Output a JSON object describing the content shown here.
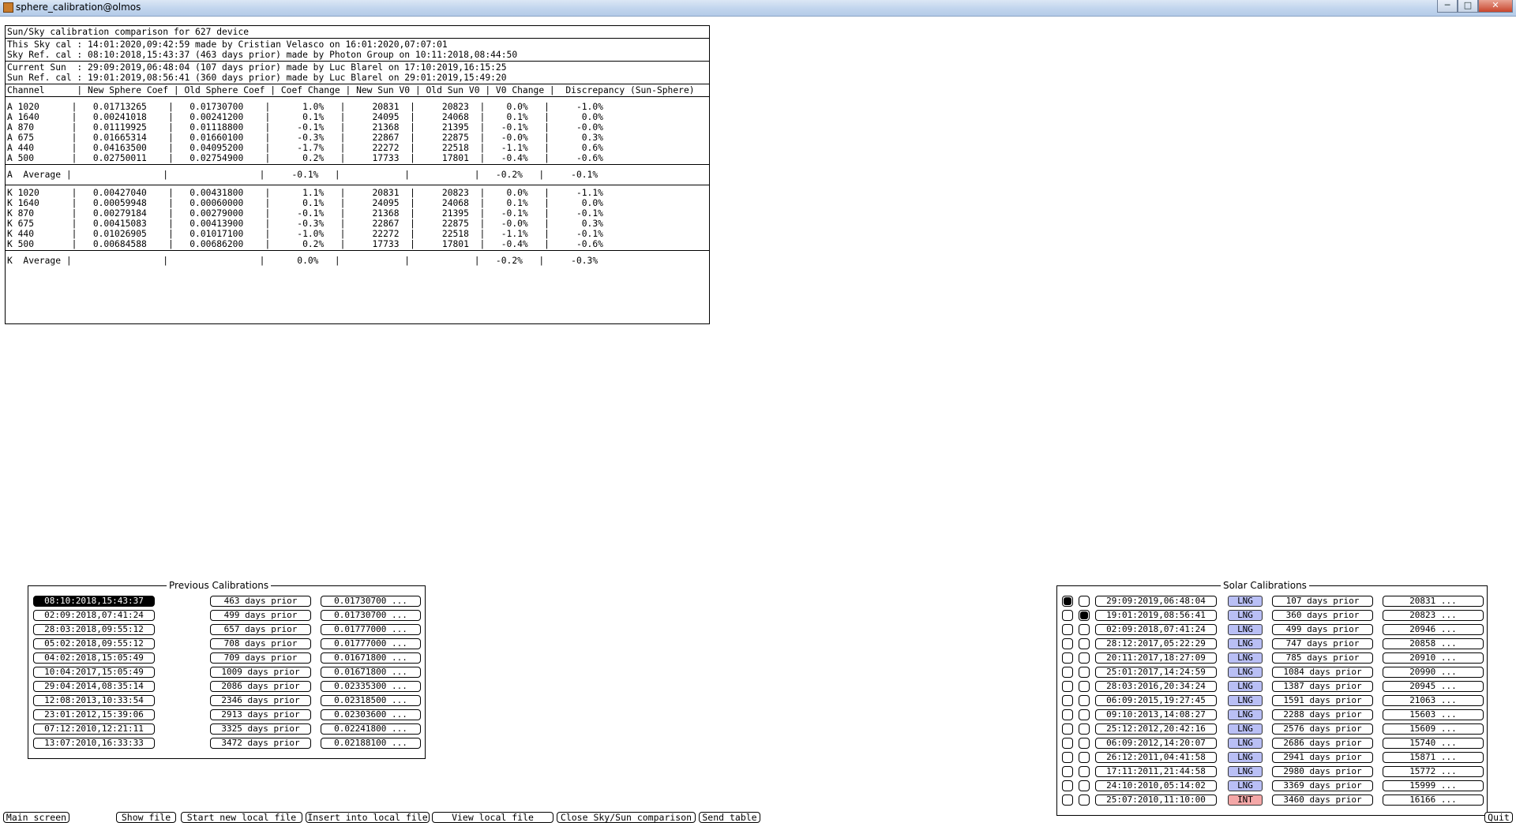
{
  "window": {
    "title": "sphere_calibration@olmos",
    "min": "─",
    "max": "□",
    "close": "✕"
  },
  "report": {
    "heading": "Sun/Sky calibration comparison for 627 device",
    "sky_lines": [
      "This Sky cal : 14:01:2020,09:42:59 made by Cristian Velasco on 16:01:2020,07:07:01",
      "Sky Ref. cal : 08:10:2018,15:43:37 (463 days prior) made by Photon Group on 10:11:2018,08:44:50"
    ],
    "sun_lines": [
      "Current Sun  : 29:09:2019,06:48:04 (107 days prior) made by Luc Blarel on 17:10:2019,16:15:25",
      "Sun Ref. cal : 19:01:2019,08:56:41 (360 days prior) made by Luc Blarel on 29:01:2019,15:49:20"
    ],
    "header": "Channel      | New Sphere Coef | Old Sphere Coef | Coef Change | New Sun V0 | Old Sun V0 | V0 Change |  Discrepancy (Sun-Sphere)",
    "a_rows": [
      "A 1020      |   0.01713265    |   0.01730700    |      1.0%   |     20831  |     20823  |    0.0%   |     -1.0%",
      "A 1640      |   0.00241018    |   0.00241200    |      0.1%   |     24095  |     24068  |    0.1%   |      0.0%",
      "A 870       |   0.01119925    |   0.01118800    |     -0.1%   |     21368  |     21395  |   -0.1%   |     -0.0%",
      "A 675       |   0.01665314    |   0.01660100    |     -0.3%   |     22867  |     22875  |   -0.0%   |      0.3%",
      "A 440       |   0.04163500    |   0.04095200    |     -1.7%   |     22272  |     22518  |   -1.1%   |      0.6%",
      "A 500       |   0.02750011    |   0.02754900    |      0.2%   |     17733  |     17801  |   -0.4%   |     -0.6%"
    ],
    "a_avg": "A  Average |                 |                 |     -0.1%   |            |            |   -0.2%   |     -0.1%",
    "k_rows": [
      "K 1020      |   0.00427040    |   0.00431800    |      1.1%   |     20831  |     20823  |    0.0%   |     -1.1%",
      "K 1640      |   0.00059948    |   0.00060000    |      0.1%   |     24095  |     24068  |    0.1%   |      0.0%",
      "K 870       |   0.00279184    |   0.00279000    |     -0.1%   |     21368  |     21395  |   -0.1%   |     -0.1%",
      "K 675       |   0.00415083    |   0.00413900    |     -0.3%   |     22867  |     22875  |   -0.0%   |      0.3%",
      "K 440       |   0.01026905    |   0.01017100    |     -1.0%   |     22272  |     22518  |   -1.1%   |     -0.1%",
      "K 500       |   0.00684588    |   0.00686200    |      0.2%   |     17733  |     17801  |   -0.4%   |     -0.6%"
    ],
    "k_avg": "K  Average |                 |                 |      0.0%   |            |            |   -0.2%   |     -0.3%"
  },
  "previous": {
    "title": "Previous Calibrations",
    "rows": [
      {
        "date": "08:10:2018,15:43:37",
        "prior": "463 days prior",
        "coef": "0.01730700 ...",
        "selected": true
      },
      {
        "date": "02:09:2018,07:41:24",
        "prior": "499 days prior",
        "coef": "0.01730700 ..."
      },
      {
        "date": "28:03:2018,09:55:12",
        "prior": "657 days prior",
        "coef": "0.01777000 ..."
      },
      {
        "date": "05:02:2018,09:55:12",
        "prior": "708 days prior",
        "coef": "0.01777000 ..."
      },
      {
        "date": "04:02:2018,15:05:49",
        "prior": "709 days prior",
        "coef": "0.01671800 ..."
      },
      {
        "date": "10:04:2017,15:05:49",
        "prior": "1009 days prior",
        "coef": "0.01671800 ..."
      },
      {
        "date": "29:04:2014,08:35:14",
        "prior": "2086 days prior",
        "coef": "0.02335300 ..."
      },
      {
        "date": "12:08:2013,10:33:54",
        "prior": "2346 days prior",
        "coef": "0.02318500 ..."
      },
      {
        "date": "23:01:2012,15:39:06",
        "prior": "2913 days prior",
        "coef": "0.02303600 ..."
      },
      {
        "date": "07:12:2010,12:21:11",
        "prior": "3325 days prior",
        "coef": "0.02241800 ..."
      },
      {
        "date": "13:07:2010,16:33:33",
        "prior": "3472 days prior",
        "coef": "0.02188100 ..."
      }
    ]
  },
  "solar": {
    "title": "Solar Calibrations",
    "rows": [
      {
        "r1": true,
        "r2": false,
        "date": "29:09:2019,06:48:04",
        "type": "LNG",
        "prior": "107 days prior",
        "v0": "20831 ..."
      },
      {
        "r1": false,
        "r2": true,
        "date": "19:01:2019,08:56:41",
        "type": "LNG",
        "prior": "360 days prior",
        "v0": "20823 ..."
      },
      {
        "r1": false,
        "r2": false,
        "date": "02:09:2018,07:41:24",
        "type": "LNG",
        "prior": "499 days prior",
        "v0": "20946 ..."
      },
      {
        "r1": false,
        "r2": false,
        "date": "28:12:2017,05:22:29",
        "type": "LNG",
        "prior": "747 days prior",
        "v0": "20858 ..."
      },
      {
        "r1": false,
        "r2": false,
        "date": "20:11:2017,18:27:09",
        "type": "LNG",
        "prior": "785 days prior",
        "v0": "20910 ..."
      },
      {
        "r1": false,
        "r2": false,
        "date": "25:01:2017,14:24:59",
        "type": "LNG",
        "prior": "1084 days prior",
        "v0": "20990 ..."
      },
      {
        "r1": false,
        "r2": false,
        "date": "28:03:2016,20:34:24",
        "type": "LNG",
        "prior": "1387 days prior",
        "v0": "20945 ..."
      },
      {
        "r1": false,
        "r2": false,
        "date": "06:09:2015,19:27:45",
        "type": "LNG",
        "prior": "1591 days prior",
        "v0": "21063 ..."
      },
      {
        "r1": false,
        "r2": false,
        "date": "09:10:2013,14:08:27",
        "type": "LNG",
        "prior": "2288 days prior",
        "v0": "15603 ..."
      },
      {
        "r1": false,
        "r2": false,
        "date": "25:12:2012,20:42:16",
        "type": "LNG",
        "prior": "2576 days prior",
        "v0": "15609 ..."
      },
      {
        "r1": false,
        "r2": false,
        "date": "06:09:2012,14:20:07",
        "type": "LNG",
        "prior": "2686 days prior",
        "v0": "15740 ..."
      },
      {
        "r1": false,
        "r2": false,
        "date": "26:12:2011,04:41:58",
        "type": "LNG",
        "prior": "2941 days prior",
        "v0": "15871 ..."
      },
      {
        "r1": false,
        "r2": false,
        "date": "17:11:2011,21:44:58",
        "type": "LNG",
        "prior": "2980 days prior",
        "v0": "15772 ..."
      },
      {
        "r1": false,
        "r2": false,
        "date": "24:10:2010,05:14:02",
        "type": "LNG",
        "prior": "3369 days prior",
        "v0": "15999 ..."
      },
      {
        "r1": false,
        "r2": false,
        "date": "25:07:2010,11:10:00",
        "type": "INT",
        "prior": "3460 days prior",
        "v0": "16166 ..."
      }
    ]
  },
  "bottom": {
    "main_screen": "Main screen",
    "show_file": "Show file",
    "start_new_local_file": "Start new local file",
    "insert_into_local_file": "Insert into local file",
    "view_local_file": "View local file",
    "close_comparison": "Close Sky/Sun comparison",
    "send_table": "Send table",
    "quit": "Quit"
  },
  "colors": {
    "lng_tag": "#b9bff5",
    "int_tag": "#f4a7a7",
    "titlebar": "#c3d6ee"
  }
}
